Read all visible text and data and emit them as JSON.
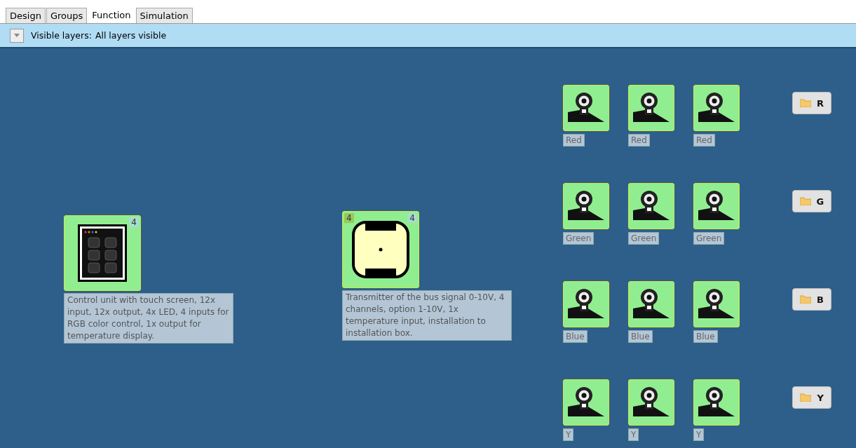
{
  "tabs": [
    {
      "label": "Design",
      "selected": false
    },
    {
      "label": "Groups",
      "selected": false
    },
    {
      "label": "Function",
      "selected": true
    },
    {
      "label": "Simulation",
      "selected": false
    }
  ],
  "layer_bar": {
    "label": "Visible layers:",
    "value": "All layers visible"
  },
  "devices": [
    {
      "kind": "control-unit",
      "badges": [
        {
          "kind": "output",
          "text": "4"
        }
      ],
      "description": "Control unit with touch screen, 12x input, 12x output, 4x LED, 4 inputs for RGB color control, 1x output for temperature display."
    },
    {
      "kind": "transmitter",
      "badges": [
        {
          "kind": "input",
          "text": "4"
        },
        {
          "kind": "output",
          "text": "4"
        }
      ],
      "description": "Transmitter of the bus signal 0-10V, 4 channels, option 1-10V, 1x temperature input, installation to installation box."
    }
  ],
  "groups": [
    {
      "button": "R",
      "lamps": [
        "Red",
        "Red",
        "Red"
      ]
    },
    {
      "button": "G",
      "lamps": [
        "Green",
        "Green",
        "Green"
      ]
    },
    {
      "button": "B",
      "lamps": [
        "Blue",
        "Blue",
        "Blue"
      ]
    },
    {
      "button": "Y",
      "lamps": [
        "Y",
        "Y",
        "Y"
      ]
    }
  ]
}
